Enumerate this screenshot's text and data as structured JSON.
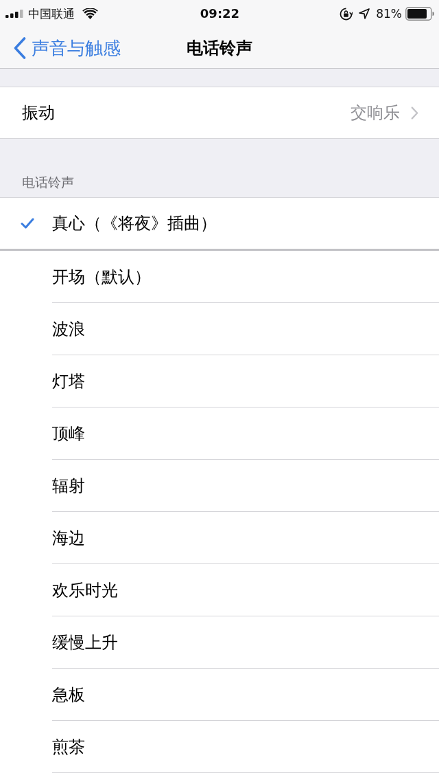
{
  "status_bar": {
    "carrier": "中国联通",
    "time": "09:22",
    "battery": "81%"
  },
  "nav_bar": {
    "back": "声音与触感",
    "title": "电话铃声"
  },
  "vibration": {
    "label": "振动",
    "value": "交响乐"
  },
  "ringtones": {
    "header": "电话铃声",
    "items": [
      {
        "label": "真心（《将夜》插曲）",
        "selected": true
      },
      {
        "label": "开场（默认）",
        "selected": false
      },
      {
        "label": "波浪",
        "selected": false
      },
      {
        "label": "灯塔",
        "selected": false
      },
      {
        "label": "顶峰",
        "selected": false
      },
      {
        "label": "辐射",
        "selected": false
      },
      {
        "label": "海边",
        "selected": false
      },
      {
        "label": "欢乐时光",
        "selected": false
      },
      {
        "label": "缓慢上升",
        "selected": false
      },
      {
        "label": "急板",
        "selected": false
      },
      {
        "label": "煎茶",
        "selected": false
      }
    ]
  }
}
